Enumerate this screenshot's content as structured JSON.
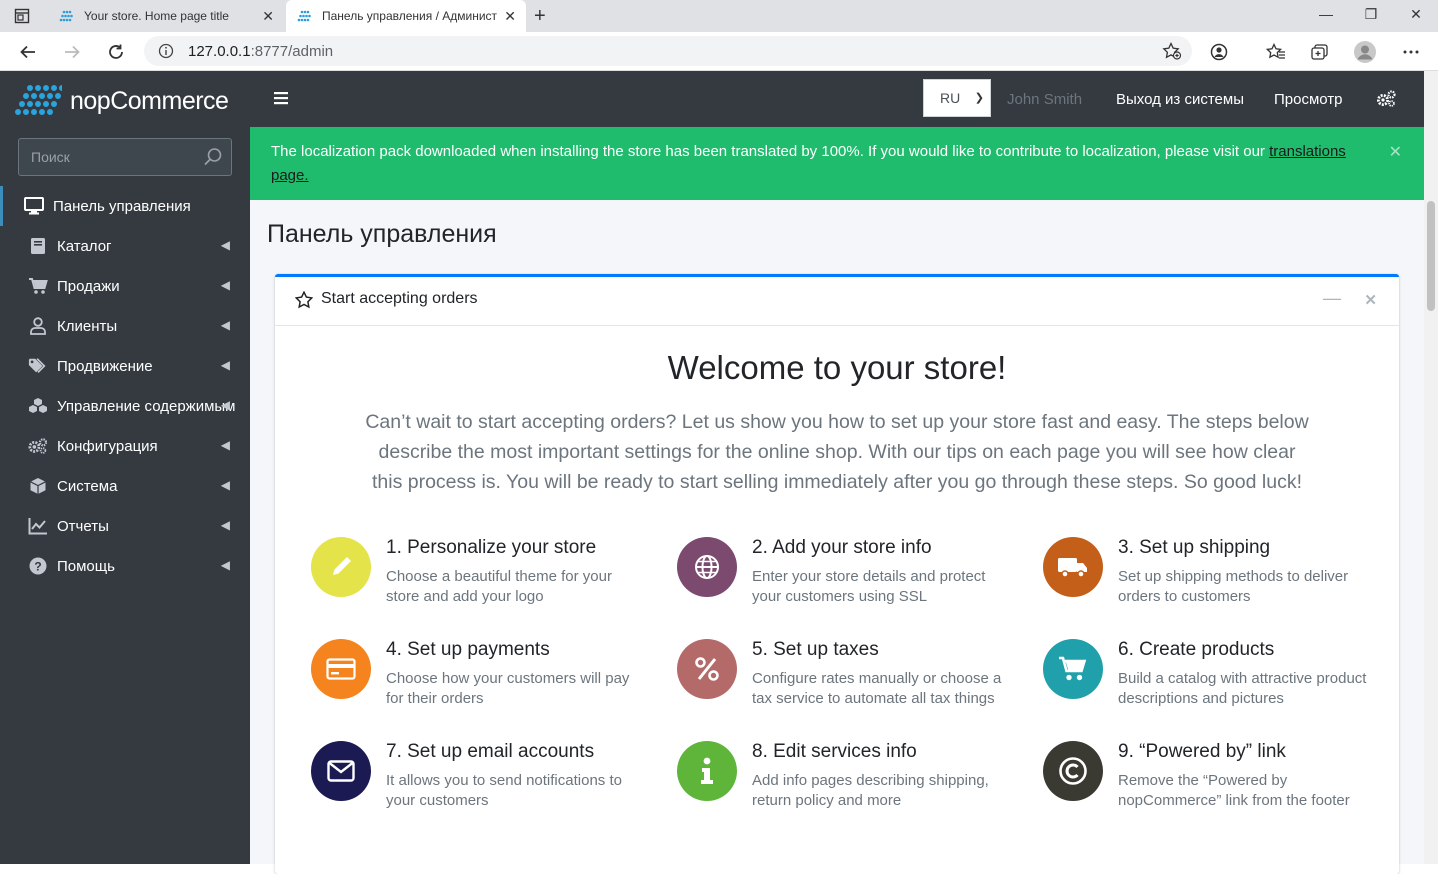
{
  "browser": {
    "tabs": [
      {
        "title": "Your store. Home page title",
        "active": false
      },
      {
        "title": "Панель управления / Админист",
        "active": true
      }
    ],
    "url_host": "127.0.0.1",
    "url_rest": ":8777/admin"
  },
  "app": {
    "logo_text": "nopCommerce",
    "search_placeholder": "Поиск",
    "nav": [
      {
        "label": "Панель управления",
        "icon": "desktop-icon",
        "active": true
      },
      {
        "label": "Каталог",
        "icon": "book-icon"
      },
      {
        "label": "Продажи",
        "icon": "cart-icon"
      },
      {
        "label": "Клиенты",
        "icon": "user-icon"
      },
      {
        "label": "Продвижение",
        "icon": "tags-icon"
      },
      {
        "label": "Управление содержимым",
        "icon": "cubes-icon"
      },
      {
        "label": "Конфигурация",
        "icon": "cogs-icon"
      },
      {
        "label": "Система",
        "icon": "cube-icon"
      },
      {
        "label": "Отчеты",
        "icon": "line-chart-icon"
      },
      {
        "label": "Помощь",
        "icon": "question-icon"
      }
    ],
    "header": {
      "language": "RU",
      "user": "John Smith",
      "logout": "Выход из системы",
      "view": "Просмотр"
    },
    "alert": {
      "text": "The localization pack downloaded when installing the store has been translated by 100%. If you would like to contribute to localization, please visit our ",
      "link": "translations page."
    },
    "page_title": "Панель управления",
    "card": {
      "title": "Start accepting orders",
      "welcome": "Welcome to your store!",
      "intro": "Can’t wait to start accepting orders? Let us show you how to set up your store fast and easy. The steps below describe the most important settings for the online shop. With our tips on each page you will see how clear this process is. You will be ready to start selling immediately after you go through these steps. So good luck!",
      "steps": [
        {
          "title": "1.  Personalize your store",
          "desc": "Choose a beautiful theme for your store and add your logo",
          "color": "#e4e34a",
          "icon": "pencil-icon"
        },
        {
          "title": "2.  Add your store info",
          "desc": "Enter your store details and protect your customers using SSL",
          "color": "#7b4a6e",
          "icon": "globe-icon"
        },
        {
          "title": "3.  Set up shipping",
          "desc": "Set up shipping methods to deliver orders to customers",
          "color": "#c45f1a",
          "icon": "truck-icon"
        },
        {
          "title": "4.  Set up payments",
          "desc": "Choose how your customers will pay for their orders",
          "color": "#f5841f",
          "icon": "credit-card-icon"
        },
        {
          "title": "5.  Set up taxes",
          "desc": "Configure rates manually or choose a tax service to automate all tax things",
          "color": "#b56a6a",
          "icon": "percent-icon"
        },
        {
          "title": "6.  Create products",
          "desc": "Build a catalog with attractive product descriptions and pictures",
          "color": "#20a0ab",
          "icon": "shopping-cart-icon"
        },
        {
          "title": "7.  Set up email accounts",
          "desc": "It allows you to send notifications to your customers",
          "color": "#1b1a52",
          "icon": "envelope-icon"
        },
        {
          "title": "8.  Edit services info",
          "desc": "Add info pages describing shipping, return policy and more",
          "color": "#5fb43a",
          "icon": "info-icon"
        },
        {
          "title": "9.  “Powered by” link",
          "desc": "Remove the “Powered by nopCommerce” link from the footer",
          "color": "#3a3a32",
          "icon": "copyright-icon"
        }
      ]
    }
  }
}
